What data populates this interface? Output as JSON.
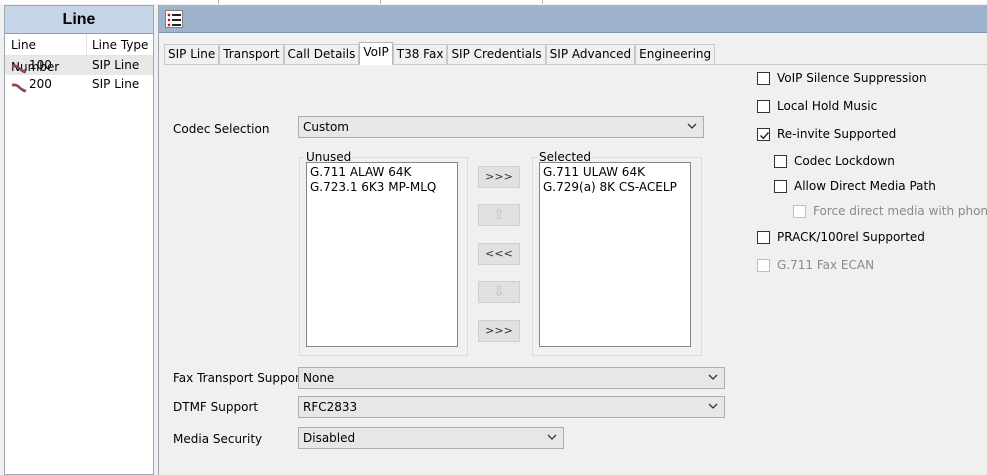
{
  "left": {
    "title": "Line",
    "columns": [
      "Line Number",
      "Line Type"
    ],
    "rows": [
      {
        "number": "100",
        "type": "SIP Line"
      },
      {
        "number": "200",
        "type": "SIP Line"
      }
    ]
  },
  "toolbar": {
    "icon": "list-icon"
  },
  "tabs": [
    "SIP Line",
    "Transport",
    "Call Details",
    "VoIP",
    "T38 Fax",
    "SIP Credentials",
    "SIP Advanced",
    "Engineering"
  ],
  "active_tab": "VoIP",
  "form": {
    "codec_label": "Codec Selection",
    "codec_value": "Custom",
    "unused_title": "Unused",
    "unused_items": [
      "G.711 ALAW 64K",
      "G.723.1 6K3 MP-MLQ"
    ],
    "selected_title": "Selected",
    "selected_items": [
      "G.711 ULAW 64K",
      "G.729(a) 8K CS-ACELP"
    ],
    "buttons": {
      "add": ">>>",
      "up": "⇧",
      "remove": "<<<",
      "down": "⇩",
      "add_all": ">>>"
    },
    "fax_label": "Fax Transport Support",
    "fax_value": "None",
    "dtmf_label": "DTMF Support",
    "dtmf_value": "RFC2833",
    "media_label": "Media Security",
    "media_value": "Disabled"
  },
  "checks": {
    "silence": {
      "label": "VoIP Silence Suppression",
      "checked": false
    },
    "hold": {
      "label": "Local Hold Music",
      "checked": false
    },
    "reinvite": {
      "label": "Re-invite Supported",
      "checked": true
    },
    "lockdown": {
      "label": "Codec Lockdown",
      "checked": false
    },
    "direct": {
      "label": "Allow Direct Media Path",
      "checked": false
    },
    "force": {
      "label": "Force direct media with phones",
      "checked": false
    },
    "prack": {
      "label": "PRACK/100rel Supported",
      "checked": false
    },
    "ecan": {
      "label": "G.711 Fax ECAN",
      "checked": false
    }
  }
}
